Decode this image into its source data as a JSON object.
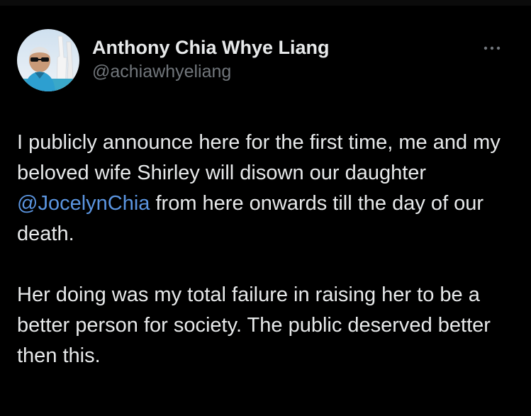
{
  "tweet": {
    "author": {
      "display_name": "Anthony Chia Whye Liang",
      "handle": "@achiawhyeliang",
      "avatar_icon": "profile-photo"
    },
    "more_icon": "more-horizontal-icon",
    "paragraph_1": {
      "before_mention": "I publicly announce here for the first time, me and my beloved wife Shirley will disown our daughter ",
      "mention": "@JocelynChia",
      "after_mention": " from here onwards till the day of our death."
    },
    "paragraph_2": "Her doing was my total failure in raising her to be a better person for society. The public deserved better then this."
  },
  "colors": {
    "background": "#000000",
    "text_primary": "#e7e9ea",
    "text_secondary": "#71767b",
    "mention": "#5b95e0"
  }
}
